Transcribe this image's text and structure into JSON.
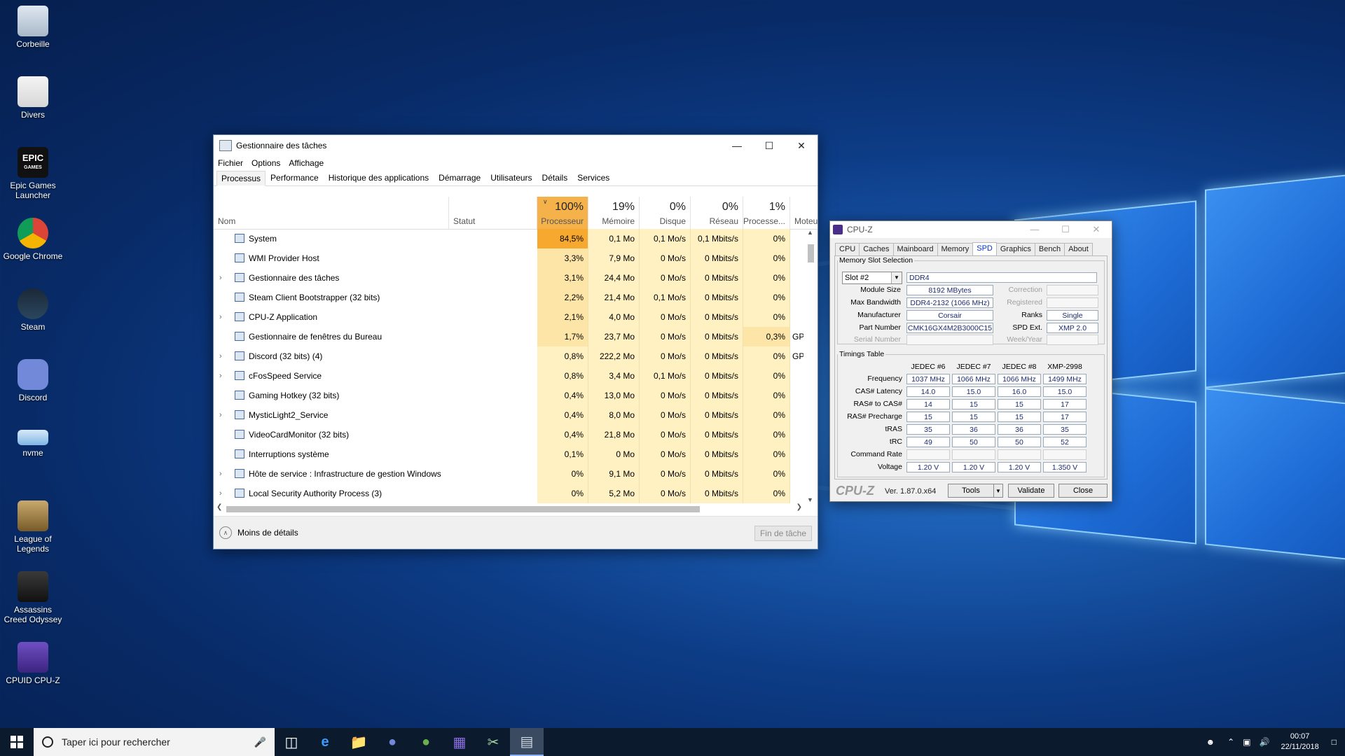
{
  "desktop": {
    "icons": [
      {
        "label": "Corbeille",
        "icon": "recycle-bin-icon"
      },
      {
        "label": "Divers",
        "icon": "folder-icon"
      },
      {
        "label": "Epic Games Launcher",
        "icon": "epic-games-icon"
      },
      {
        "label": "Google Chrome",
        "icon": "chrome-icon"
      },
      {
        "label": "Steam",
        "icon": "steam-icon"
      },
      {
        "label": "Discord",
        "icon": "discord-icon"
      },
      {
        "label": "nvme",
        "icon": "drive-icon"
      },
      {
        "label": "League of Legends",
        "icon": "league-icon"
      },
      {
        "label": "Assassins Creed Odyssey",
        "icon": "assassins-creed-icon"
      },
      {
        "label": "CPUID CPU-Z",
        "icon": "cpuz-icon"
      }
    ],
    "epic_logo_text": "EPIC",
    "epic_logo_sub": "GAMES"
  },
  "taskmanager": {
    "title": "Gestionnaire des tâches",
    "menu": [
      "Fichier",
      "Options",
      "Affichage"
    ],
    "tabs": [
      "Processus",
      "Performance",
      "Historique des applications",
      "Démarrage",
      "Utilisateurs",
      "Détails",
      "Services"
    ],
    "active_tab": "Processus",
    "columns": {
      "name": "Nom",
      "status": "Statut",
      "cpu": {
        "pct": "100%",
        "label": "Processeur"
      },
      "mem": {
        "pct": "19%",
        "label": "Mémoire"
      },
      "disk": {
        "pct": "0%",
        "label": "Disque"
      },
      "net": {
        "pct": "0%",
        "label": "Réseau"
      },
      "gpu": {
        "pct": "1%",
        "label": "Processe..."
      },
      "engine": {
        "label": "Moteu"
      }
    },
    "rows": [
      {
        "name": "System",
        "expand": false,
        "cpu": "84,5%",
        "mem": "0,1 Mo",
        "disk": "0,1 Mo/s",
        "net": "0,1 Mbits/s",
        "gpu": "0%",
        "engine": ""
      },
      {
        "name": "WMI Provider Host",
        "expand": false,
        "cpu": "3,3%",
        "mem": "7,9 Mo",
        "disk": "0 Mo/s",
        "net": "0 Mbits/s",
        "gpu": "0%",
        "engine": ""
      },
      {
        "name": "Gestionnaire des tâches",
        "expand": true,
        "cpu": "3,1%",
        "mem": "24,4 Mo",
        "disk": "0 Mo/s",
        "net": "0 Mbits/s",
        "gpu": "0%",
        "engine": ""
      },
      {
        "name": "Steam Client Bootstrapper (32 bits)",
        "expand": false,
        "cpu": "2,2%",
        "mem": "21,4 Mo",
        "disk": "0,1 Mo/s",
        "net": "0 Mbits/s",
        "gpu": "0%",
        "engine": ""
      },
      {
        "name": "CPU-Z Application",
        "expand": true,
        "cpu": "2,1%",
        "mem": "4,0 Mo",
        "disk": "0 Mo/s",
        "net": "0 Mbits/s",
        "gpu": "0%",
        "engine": ""
      },
      {
        "name": "Gestionnaire de fenêtres du Bureau",
        "expand": false,
        "cpu": "1,7%",
        "mem": "23,7 Mo",
        "disk": "0 Mo/s",
        "net": "0 Mbits/s",
        "gpu": "0,3%",
        "engine": "GPI"
      },
      {
        "name": "Discord (32 bits) (4)",
        "expand": true,
        "cpu": "0,8%",
        "mem": "222,2 Mo",
        "disk": "0 Mo/s",
        "net": "0 Mbits/s",
        "gpu": "0%",
        "engine": "GPI"
      },
      {
        "name": "cFosSpeed Service",
        "expand": true,
        "cpu": "0,8%",
        "mem": "3,4 Mo",
        "disk": "0,1 Mo/s",
        "net": "0 Mbits/s",
        "gpu": "0%",
        "engine": ""
      },
      {
        "name": "Gaming Hotkey (32 bits)",
        "expand": false,
        "cpu": "0,4%",
        "mem": "13,0 Mo",
        "disk": "0 Mo/s",
        "net": "0 Mbits/s",
        "gpu": "0%",
        "engine": ""
      },
      {
        "name": "MysticLight2_Service",
        "expand": true,
        "cpu": "0,4%",
        "mem": "8,0 Mo",
        "disk": "0 Mo/s",
        "net": "0 Mbits/s",
        "gpu": "0%",
        "engine": ""
      },
      {
        "name": "VideoCardMonitor (32 bits)",
        "expand": false,
        "cpu": "0,4%",
        "mem": "21,8 Mo",
        "disk": "0 Mo/s",
        "net": "0 Mbits/s",
        "gpu": "0%",
        "engine": ""
      },
      {
        "name": "Interruptions système",
        "expand": false,
        "cpu": "0,1%",
        "mem": "0 Mo",
        "disk": "0 Mo/s",
        "net": "0 Mbits/s",
        "gpu": "0%",
        "engine": ""
      },
      {
        "name": "Hôte de service : Infrastructure de gestion Windows",
        "expand": true,
        "cpu": "0%",
        "mem": "9,1 Mo",
        "disk": "0 Mo/s",
        "net": "0 Mbits/s",
        "gpu": "0%",
        "engine": ""
      },
      {
        "name": "Local Security Authority Process (3)",
        "expand": true,
        "cpu": "0%",
        "mem": "5,2 Mo",
        "disk": "0 Mo/s",
        "net": "0 Mbits/s",
        "gpu": "0%",
        "engine": ""
      }
    ],
    "fewer_details": "Moins de détails",
    "end_task": "Fin de tâche"
  },
  "cpuz": {
    "title": "CPU-Z",
    "tabs": [
      "CPU",
      "Caches",
      "Mainboard",
      "Memory",
      "SPD",
      "Graphics",
      "Bench",
      "About"
    ],
    "active_tab": "SPD",
    "slot_group": "Memory Slot Selection",
    "slot": "Slot #2",
    "type": "DDR4",
    "module_size_label": "Module Size",
    "module_size": "8192 MBytes",
    "max_bw_label": "Max Bandwidth",
    "max_bw": "DDR4-2132 (1066 MHz)",
    "manufacturer_label": "Manufacturer",
    "manufacturer": "Corsair",
    "part_label": "Part Number",
    "part": "CMK16GX4M2B3000C15",
    "serial_label": "Serial Number",
    "correction_label": "Correction",
    "registered_label": "Registered",
    "ranks_label": "Ranks",
    "ranks": "Single",
    "spd_ext_label": "SPD Ext.",
    "spd_ext": "XMP 2.0",
    "week_label": "Week/Year",
    "timings_group": "Timings Table",
    "timing_cols": [
      "JEDEC #6",
      "JEDEC #7",
      "JEDEC #8",
      "XMP-2998"
    ],
    "timing_rows": [
      {
        "label": "Frequency",
        "values": [
          "1037 MHz",
          "1066 MHz",
          "1066 MHz",
          "1499 MHz"
        ]
      },
      {
        "label": "CAS# Latency",
        "values": [
          "14.0",
          "15.0",
          "16.0",
          "15.0"
        ]
      },
      {
        "label": "RAS# to CAS#",
        "values": [
          "14",
          "15",
          "15",
          "17"
        ]
      },
      {
        "label": "RAS# Precharge",
        "values": [
          "15",
          "15",
          "15",
          "17"
        ]
      },
      {
        "label": "tRAS",
        "values": [
          "35",
          "36",
          "36",
          "35"
        ]
      },
      {
        "label": "tRC",
        "values": [
          "49",
          "50",
          "50",
          "52"
        ]
      },
      {
        "label": "Command Rate",
        "values": [
          "",
          "",
          "",
          ""
        ]
      },
      {
        "label": "Voltage",
        "values": [
          "1.20 V",
          "1.20 V",
          "1.20 V",
          "1.350 V"
        ]
      }
    ],
    "brand": "CPU-Z",
    "version": "Ver. 1.87.0.x64",
    "tools": "Tools",
    "validate": "Validate",
    "close": "Close"
  },
  "taskbar": {
    "search_placeholder": "Taper ici pour rechercher",
    "apps": [
      "task-view-icon",
      "edge-icon",
      "file-explorer-icon",
      "discord-taskbar-icon",
      "utorrent-icon",
      "cpuz-taskbar-icon",
      "snip-icon",
      "taskmanager-taskbar-icon"
    ],
    "time": "00:07",
    "date": "22/11/2018"
  },
  "colors": {
    "cpu_heavy": "#f7a92f",
    "cpu_col": "#fde9b0",
    "col_light": "#fff4c9",
    "accent": "#0c1a2e"
  }
}
